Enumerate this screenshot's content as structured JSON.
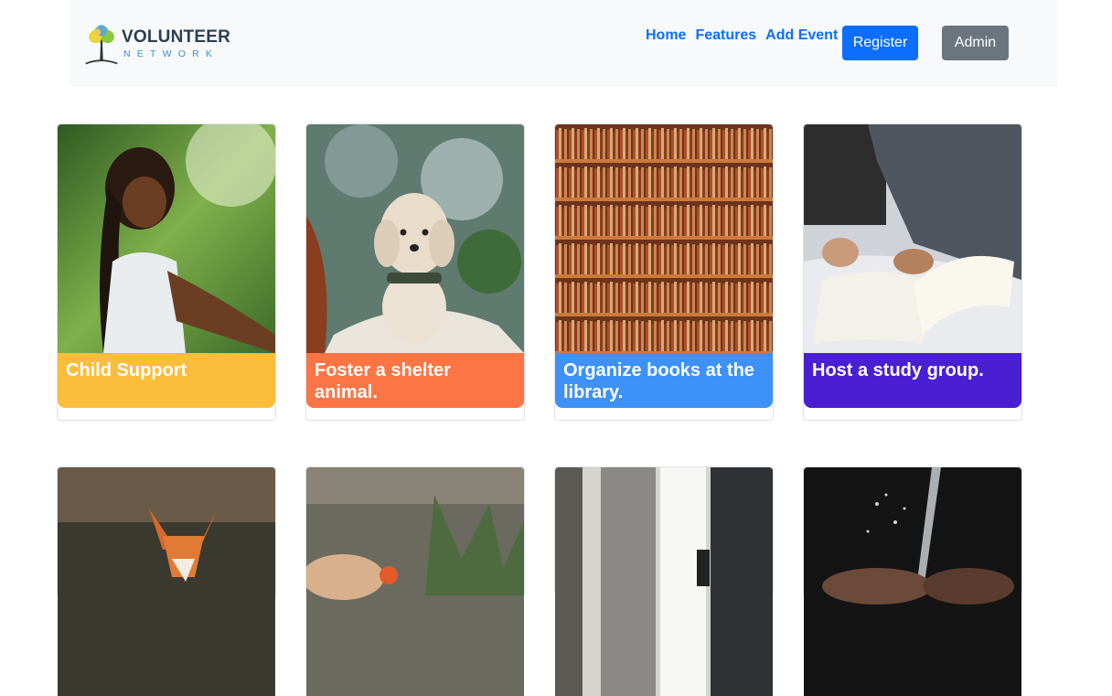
{
  "brand": {
    "title": "VOLUNTEER",
    "subtitle": "NETWORK"
  },
  "nav": {
    "links": [
      "Home",
      "Features",
      "Add Event"
    ]
  },
  "buttons": {
    "register": "Register",
    "admin": "Admin"
  },
  "cards": [
    {
      "title": "Child Support",
      "color": "#fbbd3c"
    },
    {
      "title": "Foster a shelter animal.",
      "color": "#fd7445"
    },
    {
      "title": "Organize books at the library.",
      "color": "#3d91f7"
    },
    {
      "title": "Host a study group.",
      "color": "#4a1fd1"
    }
  ],
  "colors": {
    "primary": "#0d6efd",
    "secondary": "#6c757d",
    "navbar_bg": "#f8f9fa"
  }
}
